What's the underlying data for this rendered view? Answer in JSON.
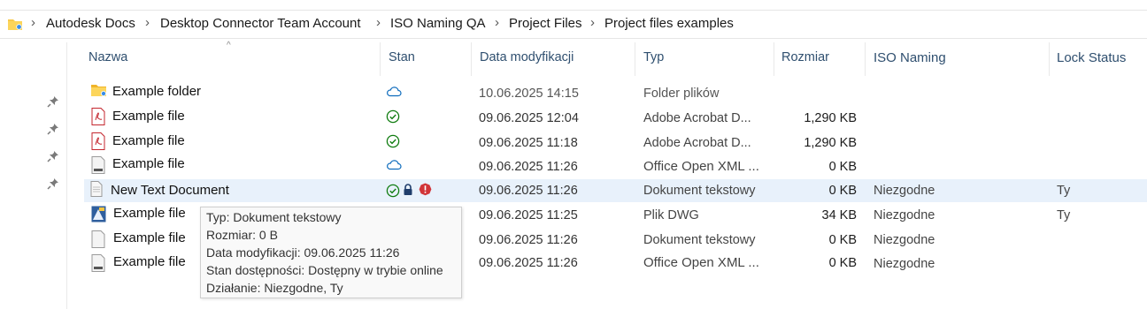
{
  "breadcrumb": {
    "items": [
      "Autodesk Docs",
      "Desktop Connector Team Account",
      "ISO Naming QA",
      "Project Files",
      "Project files examples"
    ],
    "separator": "›"
  },
  "columns": {
    "name": "Nazwa",
    "status": "Stan",
    "modified": "Data modyfikacji",
    "type": "Typ",
    "size": "Rozmiar",
    "iso": "ISO Naming",
    "lock": "Lock Status"
  },
  "rows": [
    {
      "name": "Example folder",
      "icon": "folder-icon",
      "status": [
        "cloud-icon"
      ],
      "modified": "10.06.2025 14:15",
      "type": "Folder plików",
      "size": "",
      "iso": "",
      "lock": ""
    },
    {
      "name": "Example file",
      "icon": "pdf-icon",
      "status": [
        "check-icon"
      ],
      "modified": "09.06.2025 12:04",
      "type": "Adobe Acrobat D...",
      "size": "1,290 KB",
      "iso": "",
      "lock": ""
    },
    {
      "name": "Example file",
      "icon": "pdf-icon",
      "status": [
        "check-icon"
      ],
      "modified": "09.06.2025 11:18",
      "type": "Adobe Acrobat D...",
      "size": "1,290 KB",
      "iso": "",
      "lock": ""
    },
    {
      "name": "Example file",
      "icon": "docx-icon",
      "status": [
        "cloud-icon"
      ],
      "modified": "09.06.2025 11:26",
      "type": "Office Open XML ...",
      "size": "0 KB",
      "iso": "",
      "lock": ""
    },
    {
      "name": "New Text Document",
      "icon": "txt-icon",
      "status": [
        "check-icon",
        "lock-icon",
        "warning-icon"
      ],
      "modified": "09.06.2025 11:26",
      "type": "Dokument tekstowy",
      "size": "0 KB",
      "iso": "Niezgodne",
      "lock": "Ty"
    },
    {
      "name": "Example file",
      "icon": "dwg-icon",
      "status": [],
      "modified": "09.06.2025 11:25",
      "type": "Plik DWG",
      "size": "34 KB",
      "iso": "Niezgodne",
      "lock": "Ty"
    },
    {
      "name": "Example file",
      "icon": "txt-icon",
      "status": [],
      "modified": "09.06.2025 11:26",
      "type": "Dokument tekstowy",
      "size": "0 KB",
      "iso": "Niezgodne",
      "lock": ""
    },
    {
      "name": "Example file",
      "icon": "docx-icon",
      "status": [],
      "modified": "09.06.2025 11:26",
      "type": "Office Open XML ...",
      "size": "0 KB",
      "iso": "Niezgodne",
      "lock": ""
    }
  ],
  "tooltip": {
    "lines": [
      "Typ: Dokument tekstowy",
      "Rozmiar: 0 B",
      "Data modyfikacji: 09.06.2025 11:26",
      "Stan dostępności: Dostępny w trybie online",
      "Działanie: Niezgodne, Ty"
    ]
  },
  "colors": {
    "header_text": "#2f4f6f",
    "selected_row": "#e8f1fb",
    "check_green": "#107c10",
    "cloud_blue": "#0f6cbd",
    "warning_red": "#d13438",
    "folder_yellow": "#f8c94a"
  }
}
